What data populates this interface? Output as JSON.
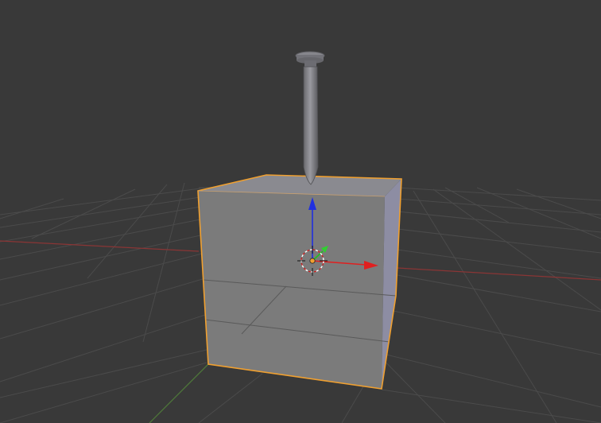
{
  "viewport": {
    "background_color": "#393939",
    "grid_color": "#4a4a4a",
    "x_axis_color": "#a83a3a",
    "y_axis_color": "#4f8a3a"
  },
  "scene": {
    "selected_object": "cube",
    "objects": [
      "cube",
      "nail"
    ],
    "cube": {
      "face_color": "#7a7a7a",
      "top_color": "#8a8a8e",
      "side_color": "#8c8ca4",
      "outline_color": "#f0a030"
    },
    "nail": {
      "color": "#808080"
    }
  },
  "gizmo": {
    "mode": "translate",
    "x_color": "#e02020",
    "y_color": "#20d020",
    "z_color": "#2020e0"
  },
  "cursor_3d": {
    "icon": "crosshair-target-icon",
    "ring_colors": [
      "#ffffff",
      "#cc2222"
    ]
  }
}
